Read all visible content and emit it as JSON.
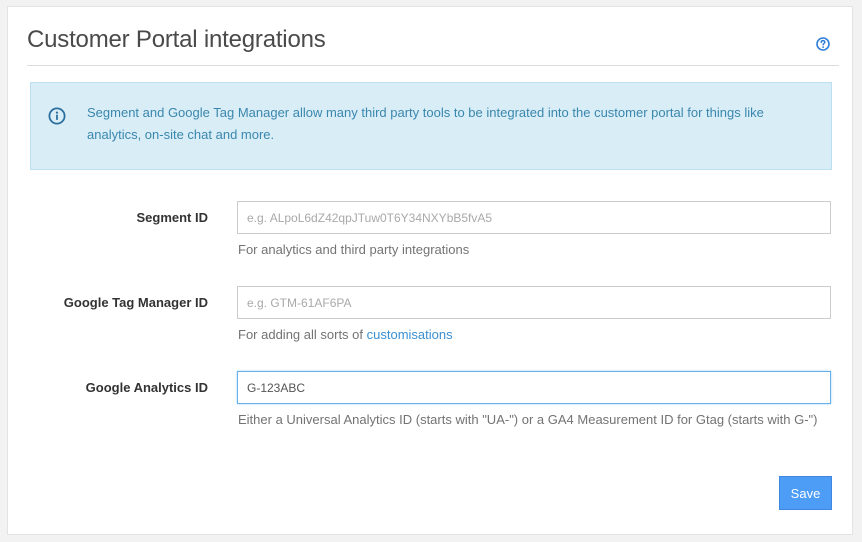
{
  "header": {
    "title": "Customer Portal integrations",
    "help_icon": "question-circle-icon"
  },
  "alert": {
    "icon": "info-circle-icon",
    "text": "Segment and Google Tag Manager allow many third party tools to be integrated into the customer portal for things like analytics, on-site chat and more."
  },
  "form": {
    "segment": {
      "label": "Segment ID",
      "value": "",
      "placeholder": "e.g. ALpoL6dZ42qpJTuw0T6Y34NXYbB5fvA5",
      "help": "For analytics and third party integrations"
    },
    "gtm": {
      "label": "Google Tag Manager ID",
      "value": "",
      "placeholder": "e.g. GTM-61AF6PA",
      "help_prefix": "For adding all sorts of ",
      "help_link": "customisations"
    },
    "ga": {
      "label": "Google Analytics ID",
      "value": "G-123ABC",
      "placeholder": "",
      "help": "Either a Universal Analytics ID (starts with \"UA-\") or a GA4 Measurement ID for Gtag (starts with G-\")"
    }
  },
  "actions": {
    "save_label": "Save"
  },
  "colors": {
    "accent": "#4d9cf6",
    "alert_bg": "#d9edf7",
    "alert_text": "#3a87ad",
    "link": "#3a8fd1"
  }
}
